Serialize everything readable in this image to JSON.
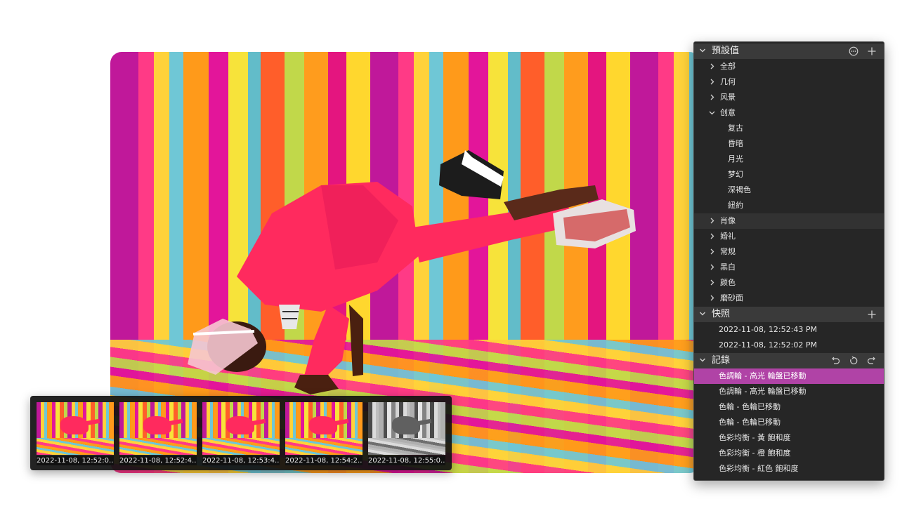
{
  "panel": {
    "presets": {
      "title": "預設值",
      "items": [
        {
          "label": "全部"
        },
        {
          "label": "几何"
        },
        {
          "label": "风景"
        },
        {
          "label": "创意"
        },
        {
          "label": "复古"
        },
        {
          "label": "昏暗"
        },
        {
          "label": "月光"
        },
        {
          "label": "梦幻"
        },
        {
          "label": "深褐色"
        },
        {
          "label": "紐約"
        },
        {
          "label": "肖像"
        },
        {
          "label": "婚礼"
        },
        {
          "label": "常规"
        },
        {
          "label": "黑白"
        },
        {
          "label": "颜色"
        },
        {
          "label": "磨砂面"
        }
      ]
    },
    "snapshots": {
      "title": "快照",
      "items": [
        {
          "label": "2022-11-08, 12:52:43 PM"
        },
        {
          "label": "2022-11-08, 12:52:02 PM"
        }
      ]
    },
    "history": {
      "title": "記錄",
      "items": [
        {
          "label": "色調輪 - 高光 輪盤已移動"
        },
        {
          "label": "色調輪 - 高光 輪盤已移動"
        },
        {
          "label": "色輪 - 色輪已移動"
        },
        {
          "label": "色輪 - 色輪已移動"
        },
        {
          "label": "色彩均衡 - 黃 飽和度"
        },
        {
          "label": "色彩均衡 - 橙 飽和度"
        },
        {
          "label": "色彩均衡 - 紅色 飽和度"
        }
      ]
    }
  },
  "filmstrip": {
    "items": [
      {
        "caption": "2022-11-08, 12:52:0..."
      },
      {
        "caption": "2022-11-08, 12:52:4..."
      },
      {
        "caption": "2022-11-08, 12:53:4..."
      },
      {
        "caption": "2022-11-08, 12:54:2..."
      },
      {
        "caption": "2022-11-08, 12:55:0..."
      }
    ]
  },
  "colors": {
    "panel_bg": "#262626",
    "section_header": "#3a3a3a",
    "selected_row": "#b043a6",
    "hover_row": "#323232"
  },
  "icons": {
    "presets_more": "ellipsis-circle-icon",
    "presets_add": "plus-icon",
    "snapshots_add": "plus-icon",
    "history_undo": "undo-icon",
    "history_reset": "reset-icon",
    "history_redo": "redo-icon",
    "expand": "chevron-right-icon",
    "collapse": "chevron-down-icon"
  }
}
